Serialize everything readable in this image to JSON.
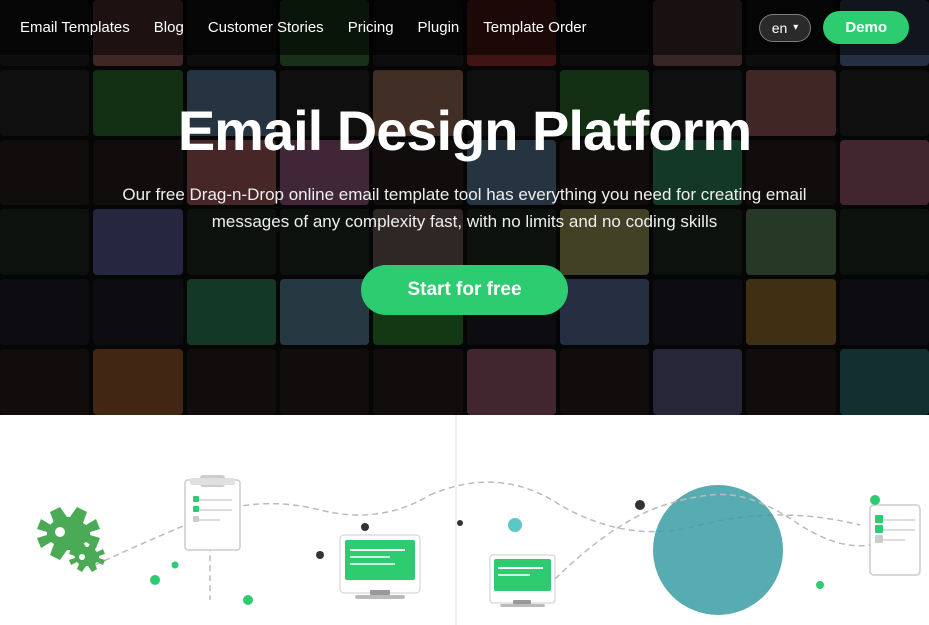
{
  "nav": {
    "links": [
      {
        "label": "Email Templates",
        "id": "email-templates"
      },
      {
        "label": "Blog",
        "id": "blog"
      },
      {
        "label": "Customer Stories",
        "id": "customer-stories"
      },
      {
        "label": "Pricing",
        "id": "pricing"
      },
      {
        "label": "Plugin",
        "id": "plugin"
      },
      {
        "label": "Template Order",
        "id": "template-order"
      }
    ],
    "lang_label": "en",
    "demo_label": "Demo"
  },
  "hero": {
    "title": "Email Design Platform",
    "subtitle": "Our free Drag-n-Drop online email template tool has everything you need for creating email messages of any complexity fast, with no limits and no coding skills",
    "cta_label": "Start for free"
  }
}
